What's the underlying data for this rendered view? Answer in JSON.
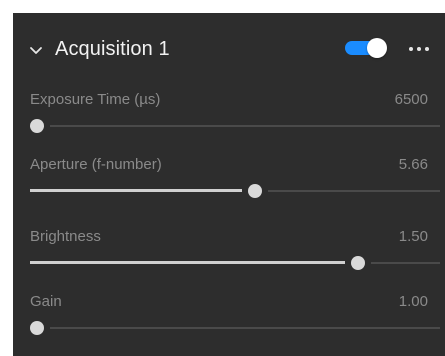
{
  "panel": {
    "title": "Acquisition 1",
    "enabled": true,
    "accent_color": "#1a8cff",
    "icons": {
      "collapse": "chevron-down-icon",
      "more": "more-horizontal-icon"
    }
  },
  "parameters": [
    {
      "label": "Exposure Time (µs)",
      "value": "6500",
      "slider_fraction": 0.0
    },
    {
      "label": "Aperture (f-number)",
      "value": "5.66",
      "slider_fraction": 0.55
    },
    {
      "label": "Brightness",
      "value": "1.50",
      "slider_fraction": 0.81
    },
    {
      "label": "Gain",
      "value": "1.00",
      "slider_fraction": 0.0
    }
  ]
}
